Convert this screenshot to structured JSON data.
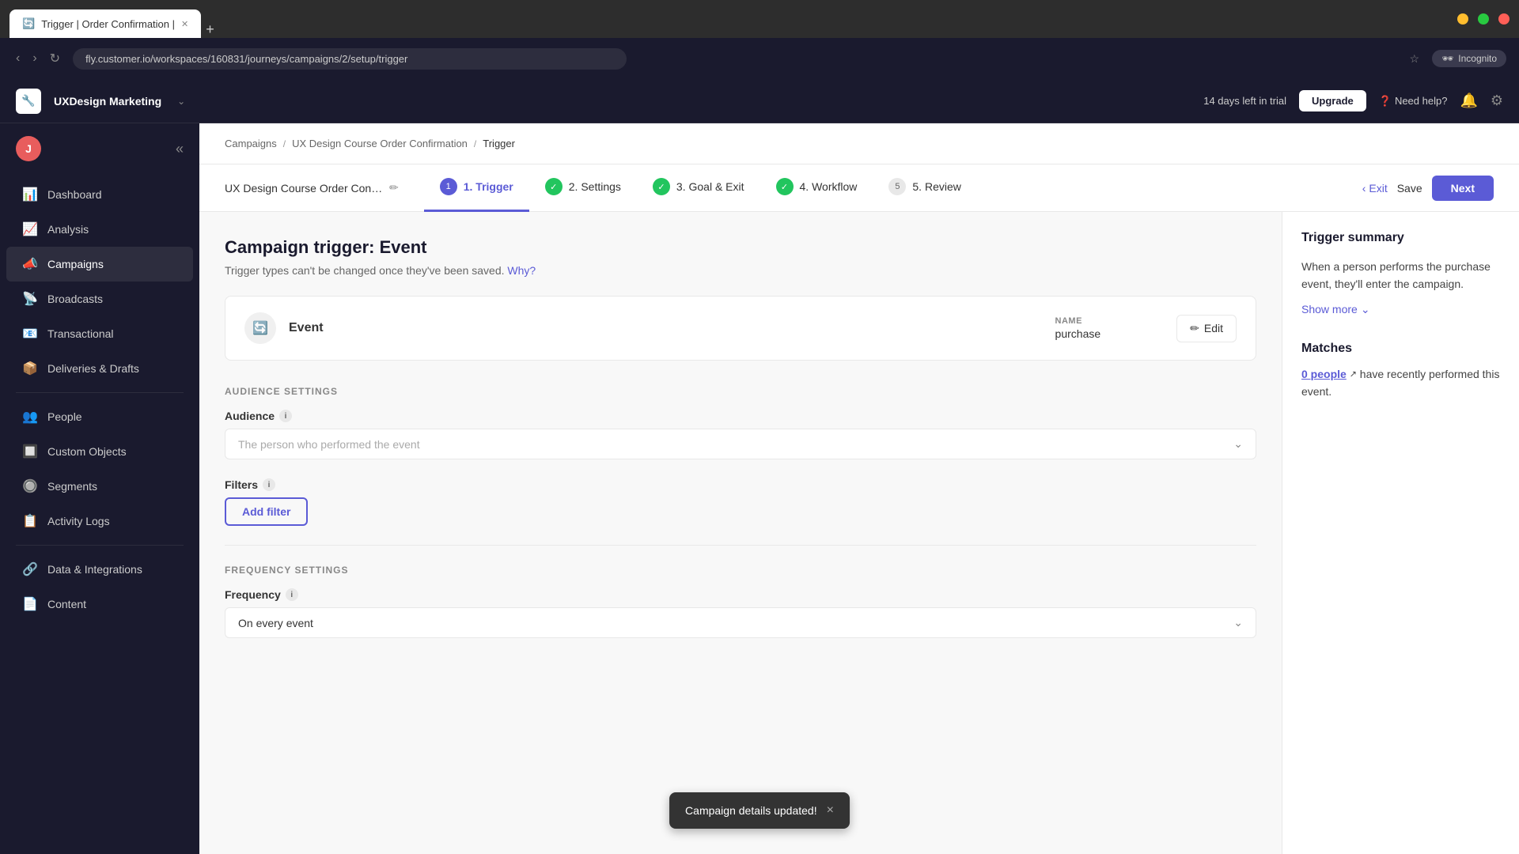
{
  "browser": {
    "tabs": [
      {
        "label": "Trigger | Order Confirmation |",
        "active": true
      },
      {
        "label": "+",
        "add": true
      }
    ],
    "address": "fly.customer.io/workspaces/160831/journeys/campaigns/2/setup/trigger"
  },
  "appHeader": {
    "workspaceName": "UXDesign Marketing",
    "trialText": "14 days left in trial",
    "upgradeLabel": "Upgrade",
    "needHelpLabel": "Need help?"
  },
  "sidebar": {
    "items": [
      {
        "id": "dashboard",
        "label": "Dashboard",
        "icon": "📊"
      },
      {
        "id": "analysis",
        "label": "Analysis",
        "icon": "📈"
      },
      {
        "id": "campaigns",
        "label": "Campaigns",
        "icon": "📣",
        "active": true
      },
      {
        "id": "broadcasts",
        "label": "Broadcasts",
        "icon": "📡"
      },
      {
        "id": "transactional",
        "label": "Transactional",
        "icon": "📧"
      },
      {
        "id": "deliveries",
        "label": "Deliveries & Drafts",
        "icon": "📦"
      },
      {
        "id": "people",
        "label": "People",
        "icon": "👥"
      },
      {
        "id": "custom-objects",
        "label": "Custom Objects",
        "icon": "🔲"
      },
      {
        "id": "segments",
        "label": "Segments",
        "icon": "🔘"
      },
      {
        "id": "activity-logs",
        "label": "Activity Logs",
        "icon": "📋"
      },
      {
        "id": "data-integrations",
        "label": "Data & Integrations",
        "icon": "🔗"
      },
      {
        "id": "content",
        "label": "Content",
        "icon": "📄"
      }
    ]
  },
  "breadcrumb": {
    "items": [
      {
        "label": "Campaigns",
        "link": true
      },
      {
        "label": "UX Design Course Order Confirmation",
        "link": true
      },
      {
        "label": "Trigger",
        "current": true
      }
    ]
  },
  "stepNav": {
    "campaignTitle": "UX Design Course Order Confi...",
    "steps": [
      {
        "number": "1",
        "label": "1. Trigger",
        "active": true,
        "completed": false
      },
      {
        "number": "2",
        "label": "2. Settings",
        "active": false,
        "completed": true
      },
      {
        "number": "3",
        "label": "3. Goal & Exit",
        "active": false,
        "completed": true
      },
      {
        "number": "4",
        "label": "4. Workflow",
        "active": false,
        "completed": true
      },
      {
        "number": "5",
        "label": "5. Review",
        "active": false,
        "completed": false
      }
    ],
    "exitLabel": "Exit",
    "saveLabel": "Save",
    "nextLabel": "Next"
  },
  "mainContent": {
    "pageTitle": "Campaign trigger: Event",
    "pageSubtitle": "Trigger types can't be changed once they've been saved.",
    "whyLinkText": "Why?",
    "eventCard": {
      "eventType": "Event",
      "nameLabel": "NAME",
      "nameValue": "purchase",
      "editLabel": "Edit"
    },
    "audienceSection": {
      "sectionLabel": "AUDIENCE SETTINGS",
      "audienceFieldLabel": "Audience",
      "audiencePlaceholder": "The person who performed the event",
      "filtersFieldLabel": "Filters",
      "addFilterLabel": "Add filter"
    },
    "frequencySection": {
      "sectionLabel": "FREQUENCY SETTINGS",
      "frequencyFieldLabel": "Frequency",
      "frequencyValue": "On every event"
    }
  },
  "rightPanel": {
    "summaryTitle": "Trigger summary",
    "summaryText": "When a person performs the purchase event, they'll enter the campaign.",
    "showMoreLabel": "Show more",
    "matchesTitle": "Matches",
    "matchesPeopleCount": "0 people",
    "matchesText": "have recently performed this event."
  },
  "toast": {
    "message": "Campaign details updated!",
    "closeLabel": "×"
  }
}
